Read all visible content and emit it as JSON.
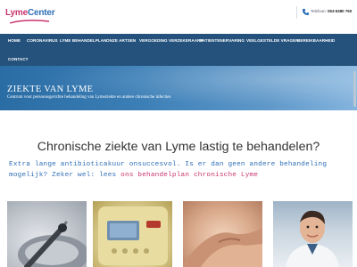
{
  "header": {
    "logo_part1": "Lyme",
    "logo_part2": "Center",
    "phone_label": "Telefoon:",
    "phone_number": "053-5380 750"
  },
  "nav": {
    "items": [
      "HOME",
      "CORONAVIRUS",
      "LYME BEHANDELPLAN",
      "ONZE ARTSEN",
      "VERGOEDING VERZEKERAARS",
      "PATIENTENERVARING",
      "VEELGESTELDE VRAGEN",
      "BEREIKBAARHEID",
      "CONTACT"
    ]
  },
  "hero": {
    "title": "ZIEKTE VAN LYME",
    "subtitle": "Centrum voor persoonsgerichte behandeling van Lymeziekte en andere chronische infecties"
  },
  "main": {
    "title": "Chronische ziekte van Lyme lastig te behandelen?",
    "subtitle_text": "Extra lange antibioticakuur onsuccesvol. Is er dan geen andere behandeling mogelijk? Zeker wel: lees ",
    "subtitle_accent": "ons behandelplan chronische Lyme"
  },
  "colors": {
    "brand_pink": "#c8356d",
    "brand_blue": "#2f6fb6",
    "nav_bg": "#24527d"
  }
}
